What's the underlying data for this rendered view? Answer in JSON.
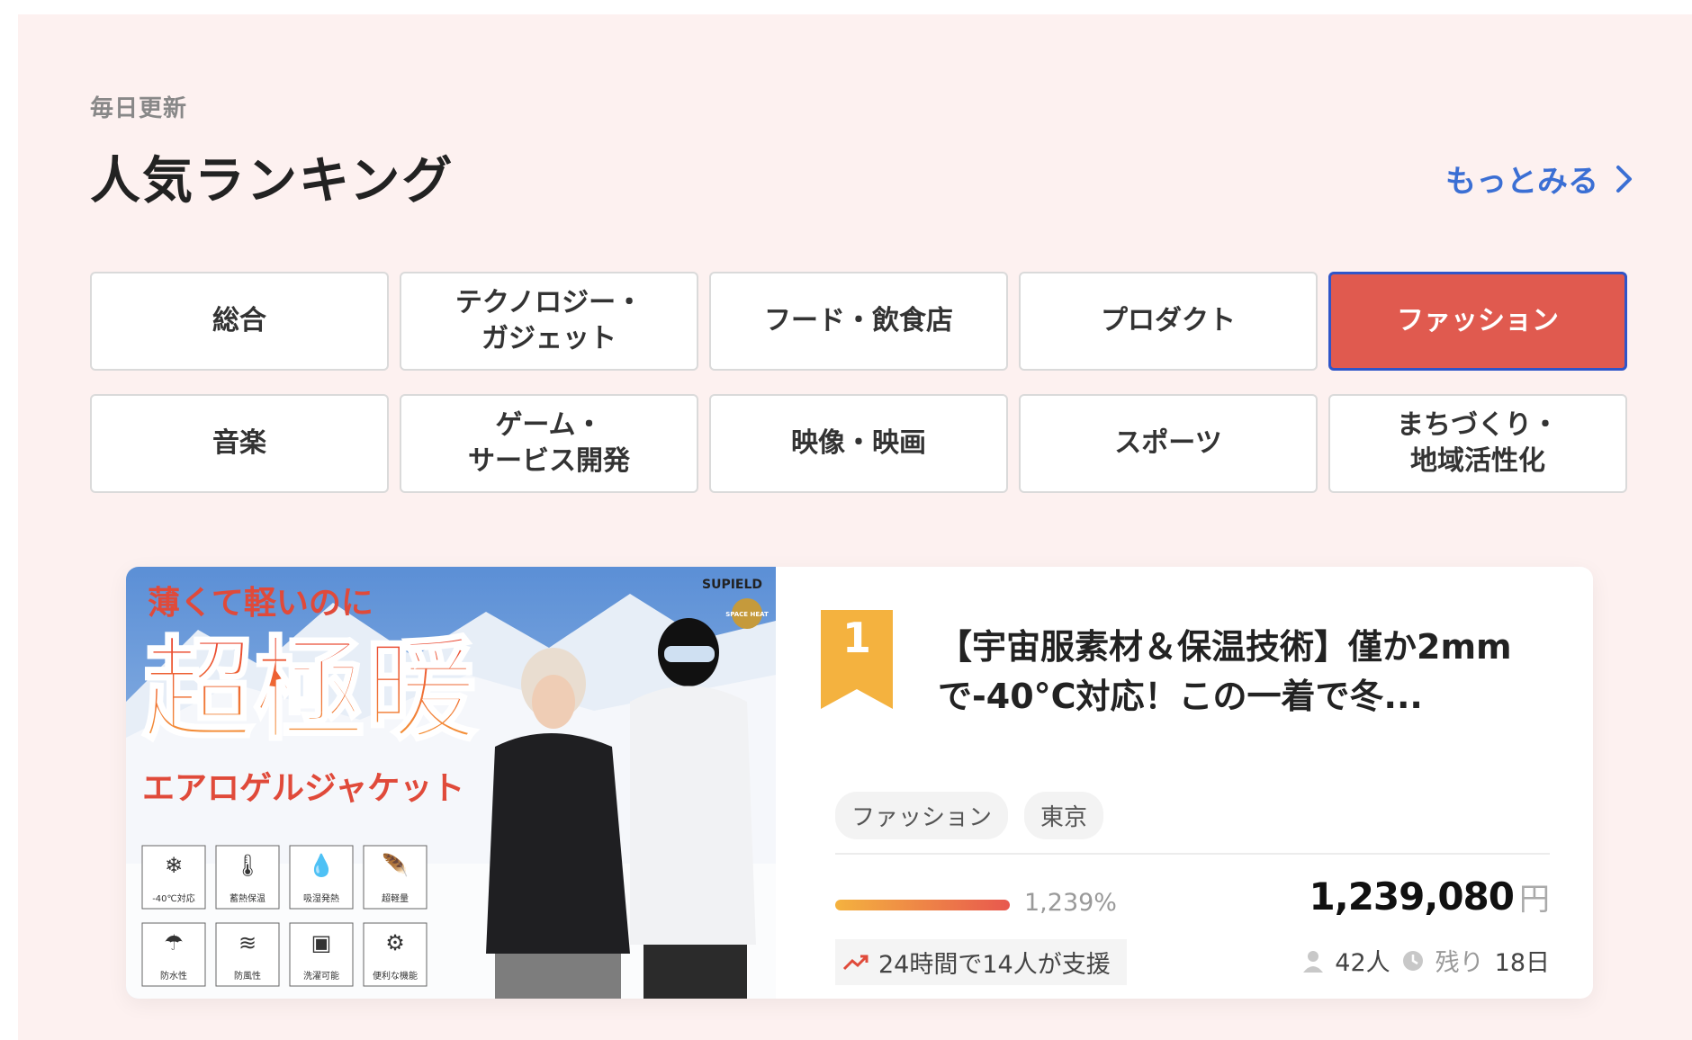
{
  "header": {
    "eyebrow": "毎日更新",
    "title": "人気ランキング",
    "more_link": "もっとみる"
  },
  "tabs": [
    {
      "label": "総合",
      "active": false
    },
    {
      "label": "テクノロジー・\nガジェット",
      "active": false
    },
    {
      "label": "フード・飲食店",
      "active": false
    },
    {
      "label": "プロダクト",
      "active": false
    },
    {
      "label": "ファッション",
      "active": true
    },
    {
      "label": "音楽",
      "active": false
    },
    {
      "label": "ゲーム・\nサービス開発",
      "active": false
    },
    {
      "label": "映像・映画",
      "active": false
    },
    {
      "label": "スポーツ",
      "active": false
    },
    {
      "label": "まちづくり・\n地域活性化",
      "active": false
    }
  ],
  "project": {
    "rank": "1",
    "title": "【宇宙服素材＆保温技術】僅か2mmで-40°C対応！この一着で冬...",
    "tags": [
      "ファッション",
      "東京"
    ],
    "progress_percent": "1,239%",
    "support_note": "24時間で14人が支援",
    "amount": "1,239,080",
    "currency": "円",
    "supporters": "42人",
    "remaining_label": "残り",
    "remaining_value": "18日",
    "image": {
      "headline_small": "薄くて軽いのに",
      "headline_big": "超極暖",
      "subtitle": "エアロゲルジャケット",
      "brand": "SUPIELD",
      "seal": "SPACE HEAT",
      "features": [
        "-40℃対応",
        "蓄熱保温",
        "吸湿発熱",
        "超軽量",
        "防水性",
        "防風性",
        "洗濯可能",
        "便利な機能"
      ]
    }
  },
  "colors": {
    "accent_red": "#e05a4f",
    "link_blue": "#3b6fd4",
    "rank_gold": "#f4b23f",
    "panel_bg": "#fdf1f0"
  }
}
